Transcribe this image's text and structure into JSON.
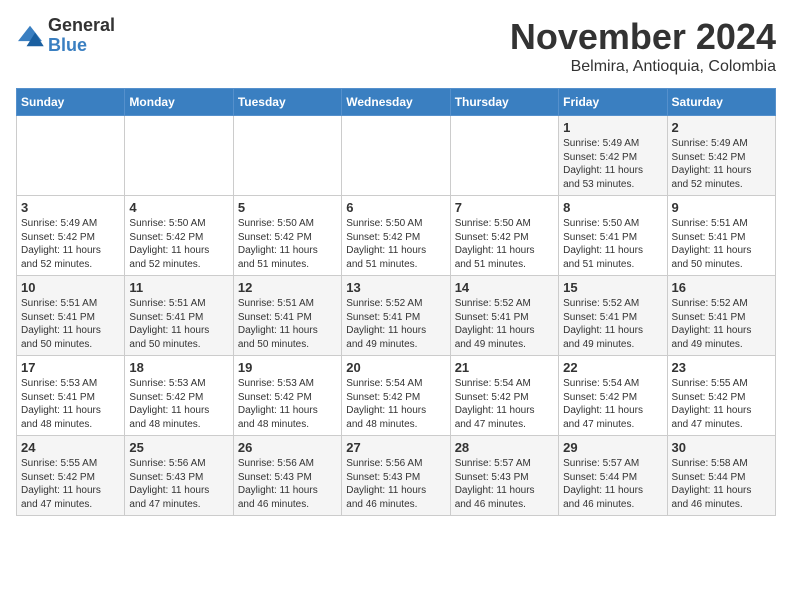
{
  "header": {
    "logo_general": "General",
    "logo_blue": "Blue",
    "month": "November 2024",
    "location": "Belmira, Antioquia, Colombia"
  },
  "weekdays": [
    "Sunday",
    "Monday",
    "Tuesday",
    "Wednesday",
    "Thursday",
    "Friday",
    "Saturday"
  ],
  "weeks": [
    [
      {
        "day": "",
        "info": ""
      },
      {
        "day": "",
        "info": ""
      },
      {
        "day": "",
        "info": ""
      },
      {
        "day": "",
        "info": ""
      },
      {
        "day": "",
        "info": ""
      },
      {
        "day": "1",
        "info": "Sunrise: 5:49 AM\nSunset: 5:42 PM\nDaylight: 11 hours\nand 53 minutes."
      },
      {
        "day": "2",
        "info": "Sunrise: 5:49 AM\nSunset: 5:42 PM\nDaylight: 11 hours\nand 52 minutes."
      }
    ],
    [
      {
        "day": "3",
        "info": "Sunrise: 5:49 AM\nSunset: 5:42 PM\nDaylight: 11 hours\nand 52 minutes."
      },
      {
        "day": "4",
        "info": "Sunrise: 5:50 AM\nSunset: 5:42 PM\nDaylight: 11 hours\nand 52 minutes."
      },
      {
        "day": "5",
        "info": "Sunrise: 5:50 AM\nSunset: 5:42 PM\nDaylight: 11 hours\nand 51 minutes."
      },
      {
        "day": "6",
        "info": "Sunrise: 5:50 AM\nSunset: 5:42 PM\nDaylight: 11 hours\nand 51 minutes."
      },
      {
        "day": "7",
        "info": "Sunrise: 5:50 AM\nSunset: 5:42 PM\nDaylight: 11 hours\nand 51 minutes."
      },
      {
        "day": "8",
        "info": "Sunrise: 5:50 AM\nSunset: 5:41 PM\nDaylight: 11 hours\nand 51 minutes."
      },
      {
        "day": "9",
        "info": "Sunrise: 5:51 AM\nSunset: 5:41 PM\nDaylight: 11 hours\nand 50 minutes."
      }
    ],
    [
      {
        "day": "10",
        "info": "Sunrise: 5:51 AM\nSunset: 5:41 PM\nDaylight: 11 hours\nand 50 minutes."
      },
      {
        "day": "11",
        "info": "Sunrise: 5:51 AM\nSunset: 5:41 PM\nDaylight: 11 hours\nand 50 minutes."
      },
      {
        "day": "12",
        "info": "Sunrise: 5:51 AM\nSunset: 5:41 PM\nDaylight: 11 hours\nand 50 minutes."
      },
      {
        "day": "13",
        "info": "Sunrise: 5:52 AM\nSunset: 5:41 PM\nDaylight: 11 hours\nand 49 minutes."
      },
      {
        "day": "14",
        "info": "Sunrise: 5:52 AM\nSunset: 5:41 PM\nDaylight: 11 hours\nand 49 minutes."
      },
      {
        "day": "15",
        "info": "Sunrise: 5:52 AM\nSunset: 5:41 PM\nDaylight: 11 hours\nand 49 minutes."
      },
      {
        "day": "16",
        "info": "Sunrise: 5:52 AM\nSunset: 5:41 PM\nDaylight: 11 hours\nand 49 minutes."
      }
    ],
    [
      {
        "day": "17",
        "info": "Sunrise: 5:53 AM\nSunset: 5:41 PM\nDaylight: 11 hours\nand 48 minutes."
      },
      {
        "day": "18",
        "info": "Sunrise: 5:53 AM\nSunset: 5:42 PM\nDaylight: 11 hours\nand 48 minutes."
      },
      {
        "day": "19",
        "info": "Sunrise: 5:53 AM\nSunset: 5:42 PM\nDaylight: 11 hours\nand 48 minutes."
      },
      {
        "day": "20",
        "info": "Sunrise: 5:54 AM\nSunset: 5:42 PM\nDaylight: 11 hours\nand 48 minutes."
      },
      {
        "day": "21",
        "info": "Sunrise: 5:54 AM\nSunset: 5:42 PM\nDaylight: 11 hours\nand 47 minutes."
      },
      {
        "day": "22",
        "info": "Sunrise: 5:54 AM\nSunset: 5:42 PM\nDaylight: 11 hours\nand 47 minutes."
      },
      {
        "day": "23",
        "info": "Sunrise: 5:55 AM\nSunset: 5:42 PM\nDaylight: 11 hours\nand 47 minutes."
      }
    ],
    [
      {
        "day": "24",
        "info": "Sunrise: 5:55 AM\nSunset: 5:42 PM\nDaylight: 11 hours\nand 47 minutes."
      },
      {
        "day": "25",
        "info": "Sunrise: 5:56 AM\nSunset: 5:43 PM\nDaylight: 11 hours\nand 47 minutes."
      },
      {
        "day": "26",
        "info": "Sunrise: 5:56 AM\nSunset: 5:43 PM\nDaylight: 11 hours\nand 46 minutes."
      },
      {
        "day": "27",
        "info": "Sunrise: 5:56 AM\nSunset: 5:43 PM\nDaylight: 11 hours\nand 46 minutes."
      },
      {
        "day": "28",
        "info": "Sunrise: 5:57 AM\nSunset: 5:43 PM\nDaylight: 11 hours\nand 46 minutes."
      },
      {
        "day": "29",
        "info": "Sunrise: 5:57 AM\nSunset: 5:44 PM\nDaylight: 11 hours\nand 46 minutes."
      },
      {
        "day": "30",
        "info": "Sunrise: 5:58 AM\nSunset: 5:44 PM\nDaylight: 11 hours\nand 46 minutes."
      }
    ]
  ]
}
